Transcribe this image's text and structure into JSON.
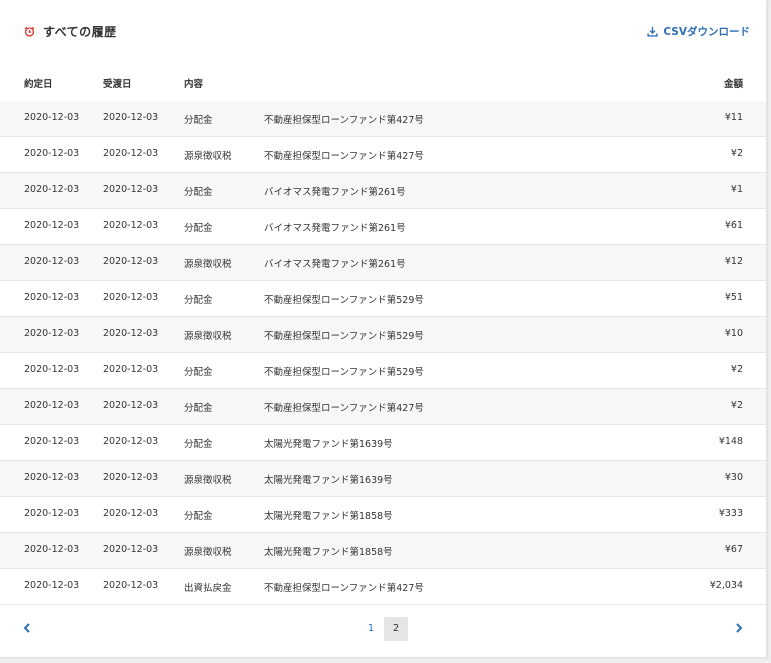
{
  "header": {
    "title": "すべての履歴",
    "csv_label": "CSVダウンロード"
  },
  "table": {
    "headers": {
      "contract_date": "約定日",
      "delivery_date": "受渡日",
      "type": "内容",
      "description": "",
      "amount": "金額"
    },
    "rows": [
      {
        "d1": "2020-12-03",
        "d2": "2020-12-03",
        "type": "分配金",
        "desc": "不動産担保型ローンファンド第427号",
        "amount": "¥11"
      },
      {
        "d1": "2020-12-03",
        "d2": "2020-12-03",
        "type": "源泉徴収税",
        "desc": "不動産担保型ローンファンド第427号",
        "amount": "¥2"
      },
      {
        "d1": "2020-12-03",
        "d2": "2020-12-03",
        "type": "分配金",
        "desc": "バイオマス発電ファンド第261号",
        "amount": "¥1"
      },
      {
        "d1": "2020-12-03",
        "d2": "2020-12-03",
        "type": "分配金",
        "desc": "バイオマス発電ファンド第261号",
        "amount": "¥61"
      },
      {
        "d1": "2020-12-03",
        "d2": "2020-12-03",
        "type": "源泉徴収税",
        "desc": "バイオマス発電ファンド第261号",
        "amount": "¥12"
      },
      {
        "d1": "2020-12-03",
        "d2": "2020-12-03",
        "type": "分配金",
        "desc": "不動産担保型ローンファンド第529号",
        "amount": "¥51"
      },
      {
        "d1": "2020-12-03",
        "d2": "2020-12-03",
        "type": "源泉徴収税",
        "desc": "不動産担保型ローンファンド第529号",
        "amount": "¥10"
      },
      {
        "d1": "2020-12-03",
        "d2": "2020-12-03",
        "type": "分配金",
        "desc": "不動産担保型ローンファンド第529号",
        "amount": "¥2"
      },
      {
        "d1": "2020-12-03",
        "d2": "2020-12-03",
        "type": "分配金",
        "desc": "不動産担保型ローンファンド第427号",
        "amount": "¥2"
      },
      {
        "d1": "2020-12-03",
        "d2": "2020-12-03",
        "type": "分配金",
        "desc": "太陽光発電ファンド第1639号",
        "amount": "¥148"
      },
      {
        "d1": "2020-12-03",
        "d2": "2020-12-03",
        "type": "源泉徴収税",
        "desc": "太陽光発電ファンド第1639号",
        "amount": "¥30"
      },
      {
        "d1": "2020-12-03",
        "d2": "2020-12-03",
        "type": "分配金",
        "desc": "太陽光発電ファンド第1858号",
        "amount": "¥333"
      },
      {
        "d1": "2020-12-03",
        "d2": "2020-12-03",
        "type": "源泉徴収税",
        "desc": "太陽光発電ファンド第1858号",
        "amount": "¥67"
      },
      {
        "d1": "2020-12-03",
        "d2": "2020-12-03",
        "type": "出資払戻金",
        "desc": "不動産担保型ローンファンド第427号",
        "amount": "¥2,034"
      }
    ]
  },
  "pagination": {
    "pages": [
      "1",
      "2"
    ],
    "current": "2"
  },
  "colors": {
    "accent": "#2f6fb3",
    "history_icon": "#d93025"
  },
  "icons": {
    "title": "history-clock-icon",
    "csv": "download-icon",
    "prev": "chevron-left-icon",
    "next": "chevron-right-icon"
  }
}
